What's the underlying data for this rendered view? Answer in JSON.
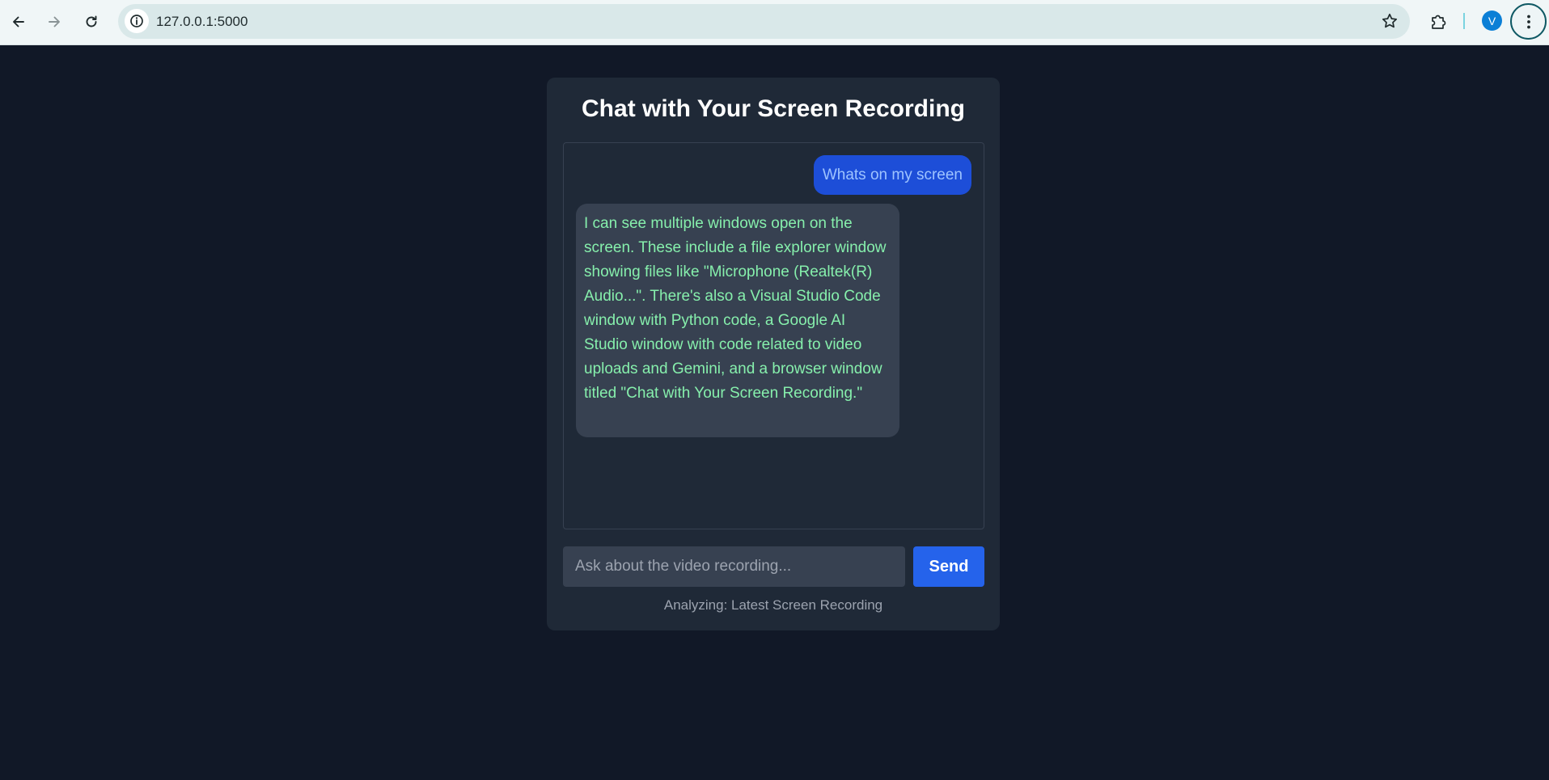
{
  "browser": {
    "url": "127.0.0.1:5000",
    "avatar_letter": "V",
    "icons": {
      "back": "arrow-left-icon",
      "forward": "arrow-right-icon",
      "reload": "reload-icon",
      "info": "info-icon",
      "bookmark": "star-icon",
      "extensions": "puzzle-icon",
      "menu": "kebab-menu-icon"
    }
  },
  "chat": {
    "title": "Chat with Your Screen Recording",
    "messages": [
      {
        "role": "user",
        "text": "Whats on my screen"
      },
      {
        "role": "assistant",
        "text": "I can see multiple windows open on the screen. These include a file explorer window showing files like \"Microphone (Realtek(R) Audio...\". There's also a Visual Studio Code window with Python code, a Google AI Studio window with code related to video uploads and Gemini, and a browser window titled \"Chat with Your Screen Recording.\""
      }
    ],
    "input": {
      "placeholder": "Ask about the video recording...",
      "value": ""
    },
    "send_label": "Send",
    "status": "Analyzing: Latest Screen Recording"
  },
  "colors": {
    "page_bg": "#111827",
    "card_bg": "#1f2937",
    "user_bubble": "#1d4ed8",
    "ai_bubble": "#374151",
    "ai_text": "#86efac",
    "send_button": "#2563eb"
  }
}
